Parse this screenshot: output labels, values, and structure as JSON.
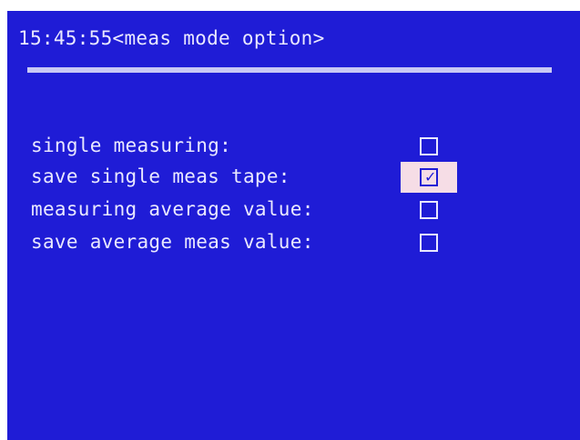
{
  "header": {
    "time": "15:45:55",
    "title": "<meas mode option>"
  },
  "options": [
    {
      "label": "single measuring:",
      "checked": false,
      "selected": false
    },
    {
      "label": "save single meas tape:",
      "checked": true,
      "selected": true
    },
    {
      "label": "measuring average value:",
      "checked": false,
      "selected": false
    },
    {
      "label": "save average meas value:",
      "checked": false,
      "selected": false
    }
  ],
  "icons": {
    "checked": "check-icon"
  },
  "colors": {
    "background": "#1f1cd6",
    "text": "#e9e8ff",
    "selection": "#f6dde6"
  }
}
